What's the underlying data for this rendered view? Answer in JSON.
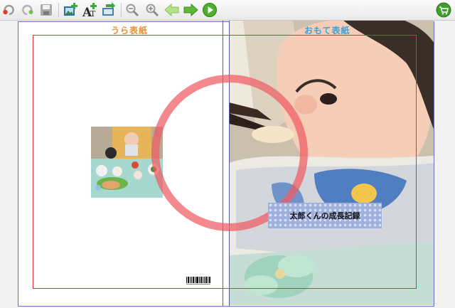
{
  "toolbar": {
    "buttons": [
      "undo-icon",
      "redo-icon",
      "save-icon",
      "add-image-icon",
      "add-text-icon",
      "export-icon",
      "zoom-out-icon",
      "zoom-in-icon",
      "previous-icon",
      "next-icon",
      "play-icon",
      "cart-icon"
    ]
  },
  "cover": {
    "back_label": "うら表紙",
    "front_label": "おもて表紙",
    "title_text": "太郎くんの成長記録"
  },
  "colors": {
    "back_label": "#e6902d",
    "front_label": "#3fa0d8",
    "safety_frame": "#d9343b",
    "sheet_border": "#6d70b8",
    "ring": "#ee5c62"
  }
}
